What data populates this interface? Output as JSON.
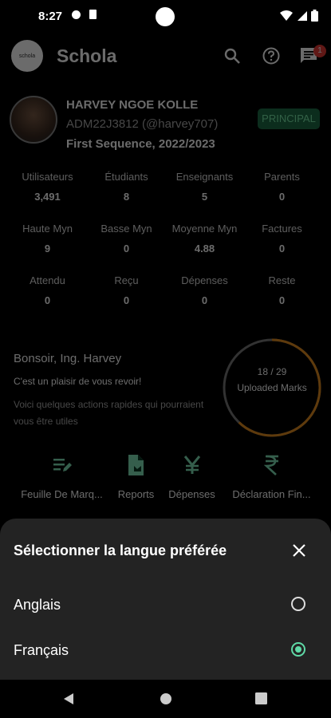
{
  "status_bar": {
    "time": "8:27"
  },
  "app_bar": {
    "logo_text": "schola",
    "title": "Schola",
    "notification_count": "1"
  },
  "profile": {
    "name": "HARVEY NGOE KOLLE",
    "id_handle": "ADM22J3812 (@harvey707)",
    "sequence": "First Sequence, 2022/2023",
    "role": "PRINCIPAL"
  },
  "stats": [
    {
      "label": "Utilisateurs",
      "value": "3,491"
    },
    {
      "label": "Étudiants",
      "value": "8"
    },
    {
      "label": "Enseignants",
      "value": "5"
    },
    {
      "label": "Parents",
      "value": "0"
    },
    {
      "label": "Haute Myn",
      "value": "9"
    },
    {
      "label": "Basse Myn",
      "value": "0"
    },
    {
      "label": "Moyenne Myn",
      "value": "4.88"
    },
    {
      "label": "Factures",
      "value": "0"
    },
    {
      "label": "Attendu",
      "value": "0"
    },
    {
      "label": "Reçu",
      "value": "0"
    },
    {
      "label": "Dépenses",
      "value": "0"
    },
    {
      "label": "Reste",
      "value": "0"
    }
  ],
  "greeting": {
    "title": "Bonsoir, Ing. Harvey",
    "subtitle": "C'est un plaisir de vous revoir!",
    "description": "Voici quelques actions rapides qui pourraient vous être utiles"
  },
  "marks": {
    "count_text": "18 / 29",
    "label": "Uploaded Marks",
    "uploaded": 18,
    "total": 29
  },
  "actions": [
    {
      "label": "Feuille De Marq...",
      "icon": "mark-sheet-icon"
    },
    {
      "label": "Reports",
      "icon": "report-icon"
    },
    {
      "label": "Dépenses",
      "icon": "yen-icon"
    },
    {
      "label": "Déclaration Fin...",
      "icon": "rupee-icon"
    }
  ],
  "language_sheet": {
    "title": "Sélectionner la langue préférée",
    "options": [
      {
        "label": "Anglais",
        "selected": false
      },
      {
        "label": "Français",
        "selected": true
      }
    ]
  },
  "colors": {
    "accent_green": "#5fd9a6",
    "progress_orange": "#e08a1e",
    "badge_red": "#e53935"
  }
}
